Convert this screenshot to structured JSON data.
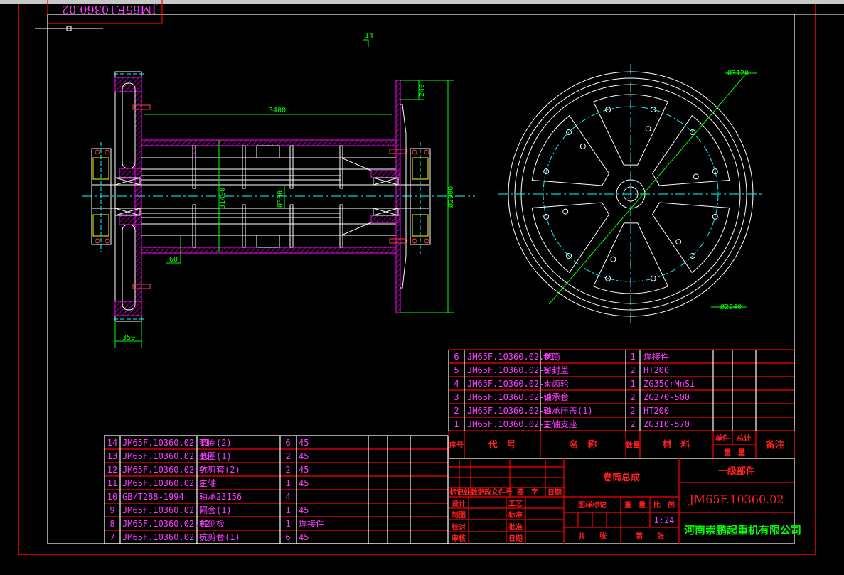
{
  "window": {
    "mirrored_title": "JM65F.10360.02"
  },
  "colors": {
    "background": "#000000",
    "frame_red": "#ff0000",
    "table_text": "#ff3cff",
    "dimension": "#00ff00",
    "centerline": "#00ffff",
    "hatch": "#ff00ff",
    "company": "#00ff00"
  },
  "dimensions": {
    "top_mark": "14",
    "length": "3400",
    "flange_height": "240",
    "flange_diameter": "Ø2900",
    "drum_diameter": "Ø1400",
    "shaft_diameter": "Ø300",
    "wall": "60",
    "gear_width": "350",
    "outer_diameter": "Ø3120",
    "bolt_circle": "Ø2240"
  },
  "parts_upper": [
    {
      "no": "6",
      "code": "JM65F.10360.02.01",
      "name": "卷筒",
      "qty": "1",
      "material": "焊接件"
    },
    {
      "no": "5",
      "code": "JM65F.10360.02-5",
      "name": "密封盖",
      "qty": "2",
      "material": "HT200"
    },
    {
      "no": "4",
      "code": "JM65F.10360.02-4",
      "name": "大齿轮",
      "qty": "1",
      "material": "ZG35CrMnSi"
    },
    {
      "no": "3",
      "code": "JM65F.10360.02-3",
      "name": "轴承套",
      "qty": "2",
      "material": "ZG270-500"
    },
    {
      "no": "2",
      "code": "JM65F.10360.02-2",
      "name": "轴承压盖(1)",
      "qty": "2",
      "material": "HT200"
    },
    {
      "no": "1",
      "code": "JM65F.10360.02-1",
      "name": "主轴支座",
      "qty": "2",
      "material": "ZG310-570"
    }
  ],
  "parts_lower": [
    {
      "no": "14",
      "code": "JM65F.10360.02-11",
      "name": "垫圈(2)",
      "qty": "6",
      "material": "45"
    },
    {
      "no": "13",
      "code": "JM65F.10360.02-10",
      "name": "垫圈(1)",
      "qty": "2",
      "material": "45"
    },
    {
      "no": "12",
      "code": "JM65F.10360.02-9",
      "name": "抗剪套(2)",
      "qty": "2",
      "material": "45"
    },
    {
      "no": "11",
      "code": "JM65F.10360.02-8",
      "name": "主轴",
      "qty": "1",
      "material": "45"
    },
    {
      "no": "10",
      "code": "GB/T288-1994",
      "name": "轴承23156",
      "qty": "4",
      "material": ""
    },
    {
      "no": "9",
      "code": "JM65F.10360.02-7",
      "name": "隔套(1)",
      "qty": "1",
      "material": "45"
    },
    {
      "no": "8",
      "code": "JM65F.10360.02.02",
      "name": "右侧板",
      "qty": "1",
      "material": "焊接件"
    },
    {
      "no": "7",
      "code": "JM65F.10360.02-6",
      "name": "抗剪套(1)",
      "qty": "6",
      "material": "45"
    }
  ],
  "header": {
    "no": "序号",
    "code": "代　号",
    "name": "名　称",
    "qty": "数量",
    "material": "材　料",
    "unit": "单件",
    "total": "总计",
    "weight": "重　量",
    "remark": "备注"
  },
  "title_block": {
    "rev_mark": "标记处数",
    "rev_doc": "更改文件号",
    "rev_sign": "签　字",
    "rev_date": "日期",
    "design": "设计",
    "process": "工艺",
    "draw": "制图",
    "standard": "标准",
    "proof": "校对",
    "approve": "批准",
    "review": "审核",
    "date": "日期",
    "drawing_name": "卷筒总成",
    "level": "一级部件",
    "drawing_no": "JM65F.10360.02",
    "sample_mark": "图样标记",
    "weight": "重　量",
    "scale_label": "比　例",
    "scale": "1:24",
    "total_sheets": "共　　张",
    "sheet": "第　　张",
    "company": "河南崇鹏起重机有限公司"
  }
}
